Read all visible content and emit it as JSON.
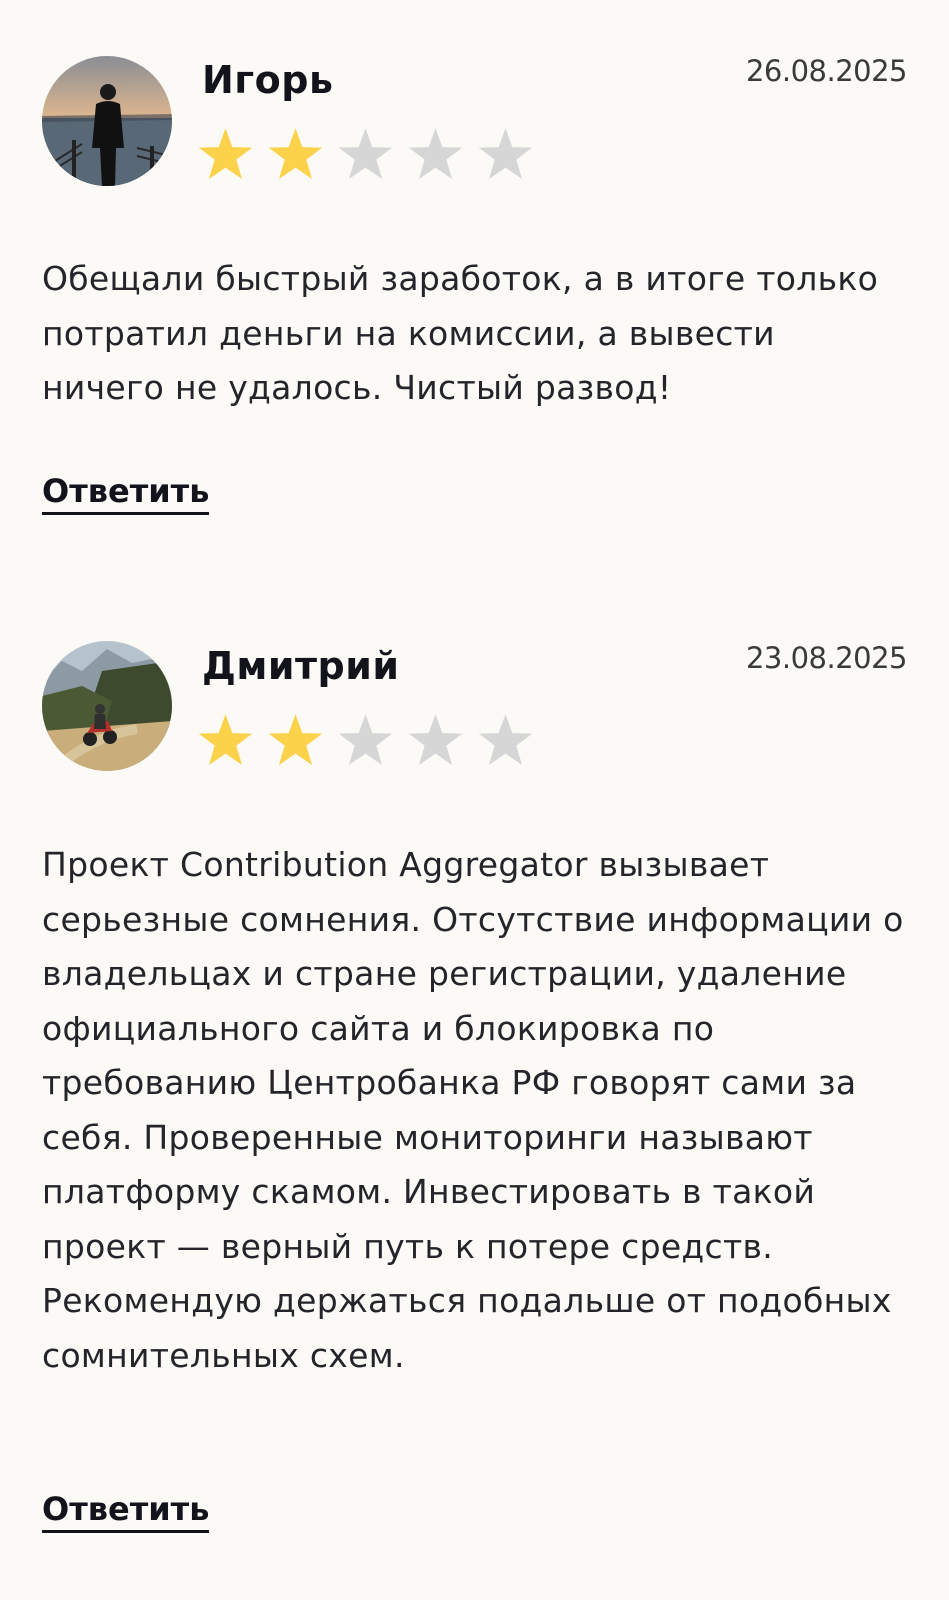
{
  "reviews": [
    {
      "author": "Игорь",
      "date": "26.08.2025",
      "avatar_icon": "avatar-photo-sea-sunset",
      "rating": 2,
      "max_rating": 5,
      "text": "Обещали быстрый заработок, а в итоге только потратил деньги на комиссии, а вывести ничего не удалось. Чистый развод!",
      "reply_label": "Ответить"
    },
    {
      "author": "Дмитрий",
      "date": "23.08.2025",
      "avatar_icon": "avatar-photo-motorcycle-forest",
      "rating": 2,
      "max_rating": 5,
      "text": "Проект Contribution Aggregator вызывает серьезные сомнения. Отсутствие информации о владельцах и стране регистрации, удаление официального сайта и блокировка по требованию Центробанка РФ говорят сами за себя. Проверенные мониторинги называют платформу скамом. Инвестировать в такой проект — верный путь к потере средств. Рекомендую держаться подальше от подобных сомнительных схем.",
      "reply_label": "Ответить"
    }
  ],
  "colors": {
    "star_filled": "#fbd24a",
    "star_empty": "#d6d6d6",
    "background": "#fbfaf7",
    "text": "#24242a"
  }
}
